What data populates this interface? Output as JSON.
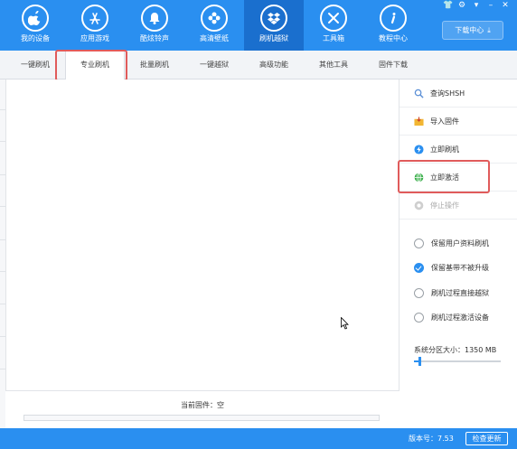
{
  "nav": {
    "items": [
      {
        "label": "我的设备",
        "icon": "apple-icon"
      },
      {
        "label": "应用游戏",
        "icon": "app-store-icon"
      },
      {
        "label": "酷炫铃声",
        "icon": "bell-icon"
      },
      {
        "label": "高清壁纸",
        "icon": "flower-icon"
      },
      {
        "label": "刷机越狱",
        "icon": "dropbox-icon",
        "active": true
      },
      {
        "label": "工具箱",
        "icon": "tools-icon"
      },
      {
        "label": "教程中心",
        "icon": "info-icon"
      }
    ],
    "download_center": "下载中心"
  },
  "window_controls": [
    "shirt-icon",
    "gear-icon",
    "dropdown-icon",
    "minimize-icon",
    "close-icon"
  ],
  "tabs": [
    {
      "label": "一键刷机"
    },
    {
      "label": "专业刷机",
      "active": true
    },
    {
      "label": "批量刷机"
    },
    {
      "label": "一键越狱"
    },
    {
      "label": "高级功能"
    },
    {
      "label": "其他工具"
    },
    {
      "label": "固件下载"
    }
  ],
  "side": {
    "actions": [
      {
        "label": "查询SHSH",
        "icon": "search-icon"
      },
      {
        "label": "导入固件",
        "icon": "folder-import-icon"
      },
      {
        "label": "立即刷机",
        "icon": "flash-icon"
      },
      {
        "label": "立即激活",
        "icon": "globe-icon"
      },
      {
        "label": "停止操作",
        "icon": "stop-icon",
        "disabled": true
      }
    ],
    "options": [
      {
        "label": "保留用户资料刷机",
        "checked": false
      },
      {
        "label": "保留基带不被升级",
        "checked": true
      },
      {
        "label": "刷机过程直接越狱",
        "checked": false
      },
      {
        "label": "刷机过程激活设备",
        "checked": false
      }
    ],
    "partition_label": "系统分区大小：1350 MB",
    "partition_slider_fraction": 0.05
  },
  "firmware": {
    "label": "当前固件：空"
  },
  "status": {
    "version": "版本号：7.53",
    "check_update": "检查更新"
  },
  "colors": {
    "primary": "#2a8ff0",
    "active_nav": "#1a6fce",
    "highlight": "#e05b5b"
  }
}
